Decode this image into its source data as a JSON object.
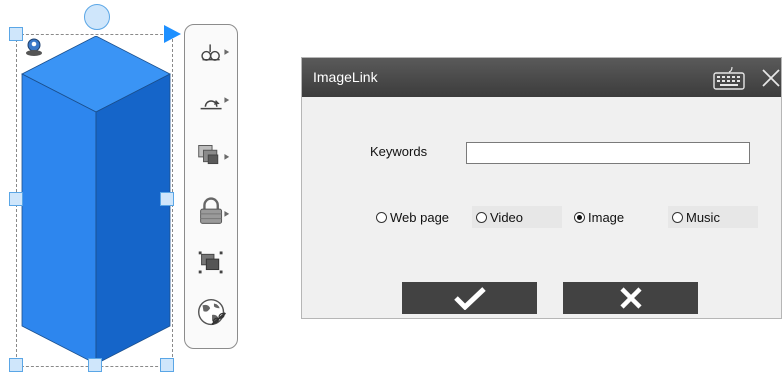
{
  "dialog": {
    "title": "ImageLink",
    "keywords_label": "Keywords",
    "keywords_value": "",
    "radio_options": [
      {
        "label": "Web page",
        "checked": false
      },
      {
        "label": "Video",
        "checked": false
      },
      {
        "label": "Image",
        "checked": true
      },
      {
        "label": "Music",
        "checked": false
      }
    ],
    "ok_icon": "checkmark-icon",
    "cancel_icon": "x-icon"
  },
  "toolbar": {
    "tools": [
      "pen-flip-icon",
      "rotate-icon",
      "arrange-layers-icon",
      "lock-icon",
      "group-icon",
      "globe-link-icon"
    ]
  },
  "colors": {
    "prism_front": "#2d86ee",
    "prism_side": "#1565c9",
    "prism_top": "#3a94f5",
    "titlebar": "#4a4a4a",
    "button": "#424242",
    "handle": "#cfe6fb"
  }
}
